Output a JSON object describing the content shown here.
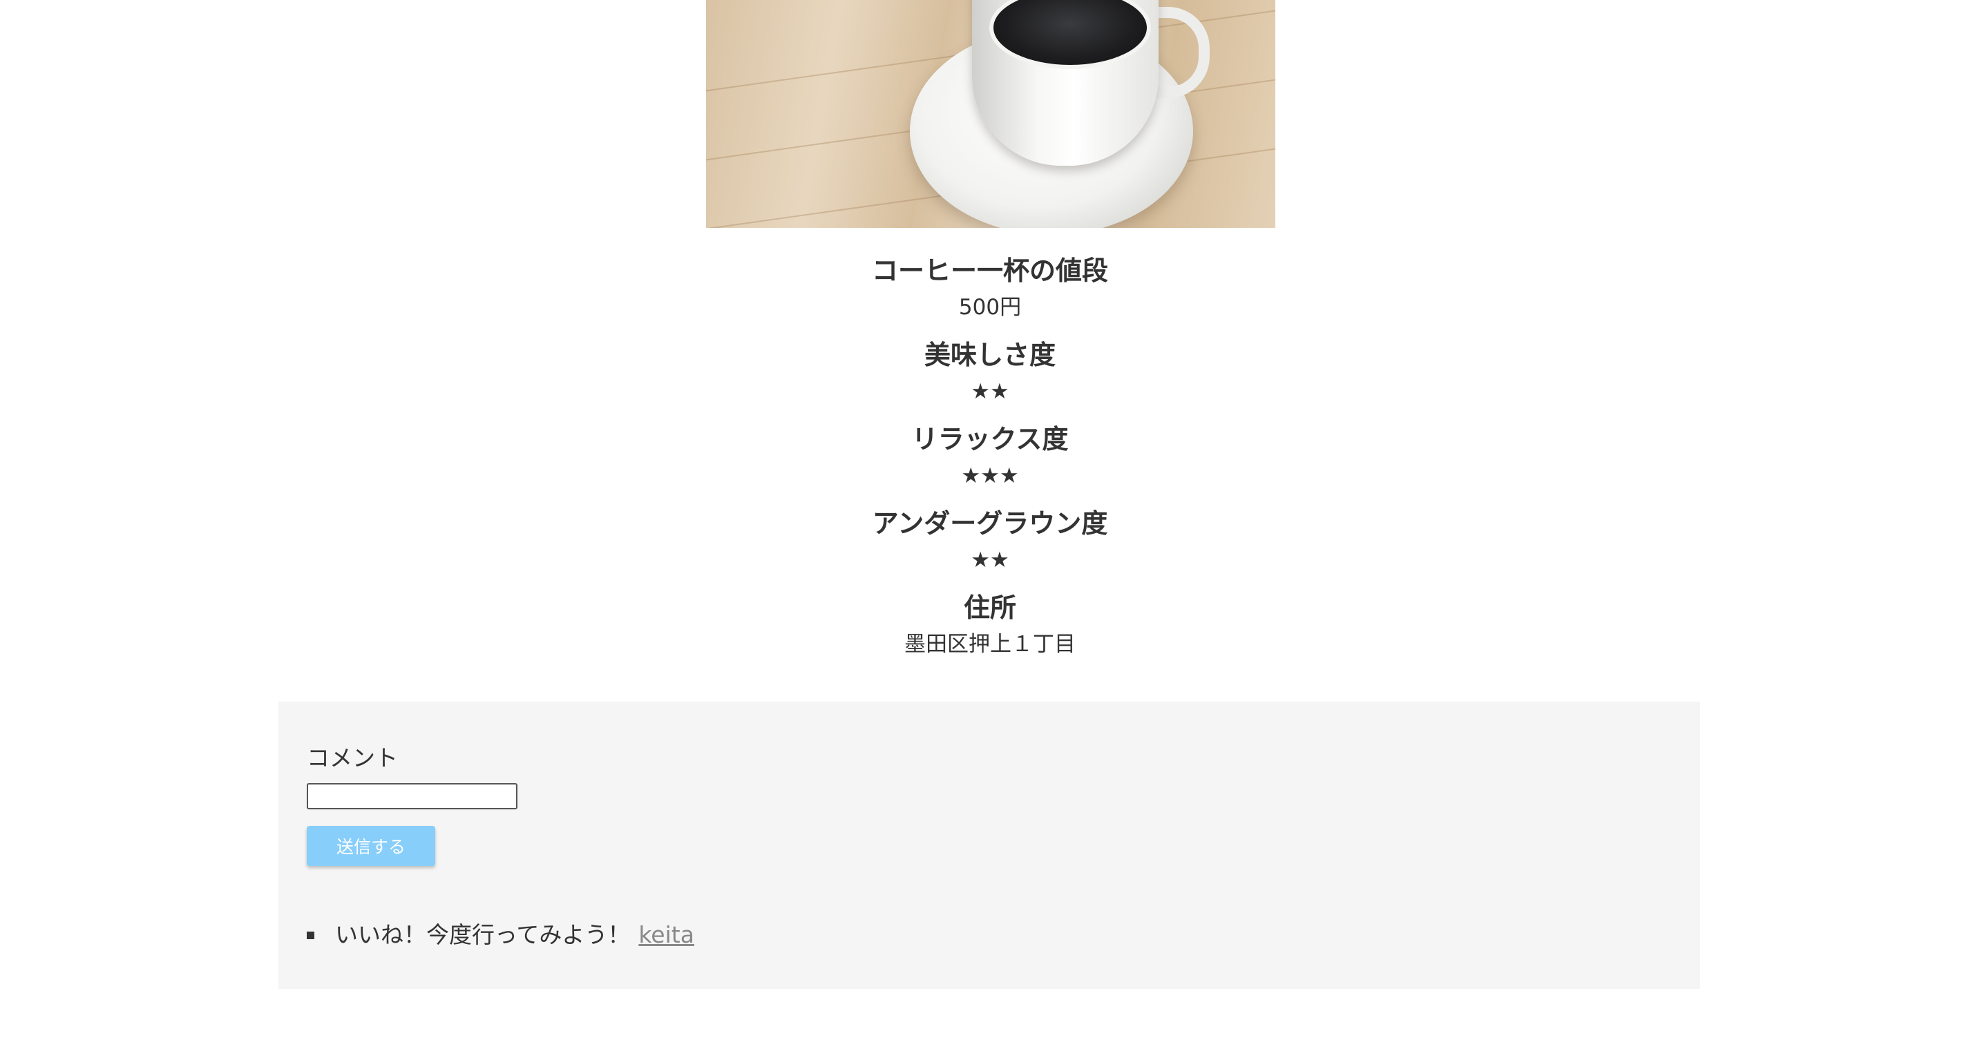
{
  "photo": {
    "subject": "coffee-cup-on-saucer"
  },
  "info": {
    "price_heading": "コーヒー一杯の値段",
    "price_value": "500円",
    "taste_heading": "美味しさ度",
    "taste_stars": "★★",
    "taste_rating": 2,
    "relax_heading": "リラックス度",
    "relax_stars": "★★★",
    "relax_rating": 3,
    "underground_heading": "アンダーグラウン度",
    "underground_stars": "★★",
    "underground_rating": 2,
    "address_heading": "住所",
    "address_value": "墨田区押上１丁目"
  },
  "comment_form": {
    "label": "コメント",
    "input_value": "",
    "submit_label": "送信する",
    "submit_color": "#87cefa"
  },
  "comments": [
    {
      "text": "いいね！今度行ってみよう！",
      "user": "keita"
    }
  ]
}
